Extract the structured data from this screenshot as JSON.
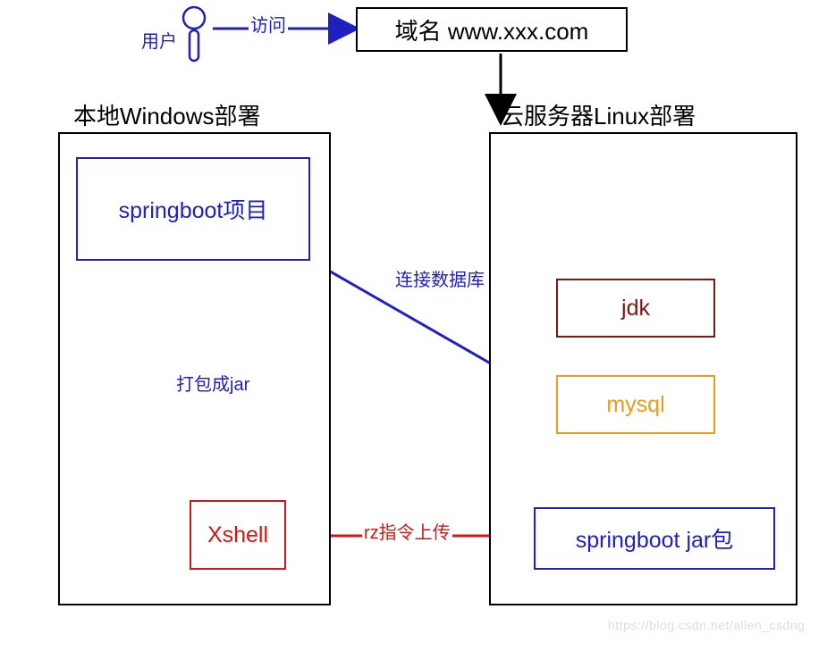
{
  "user_label": "用户",
  "domain_box": "域名 www.xxx.com",
  "local_title": "本地Windows部署",
  "cloud_title": "云服务器Linux部署",
  "springboot_project": "springboot项目",
  "xshell": "Xshell",
  "jdk": "jdk",
  "mysql": "mysql",
  "springboot_jar": "springboot  jar包",
  "edge_visit": "访问",
  "edge_package": "打包成jar",
  "edge_db": "连接数据库",
  "edge_upload": "rz指令上传",
  "watermark": "https://blog.csdn.net/allen_csdng",
  "colors": {
    "blue": "#2020c0",
    "red": "#d01818",
    "orange": "#ee9a1c",
    "darkred": "#7a1818",
    "black": "#000000"
  }
}
